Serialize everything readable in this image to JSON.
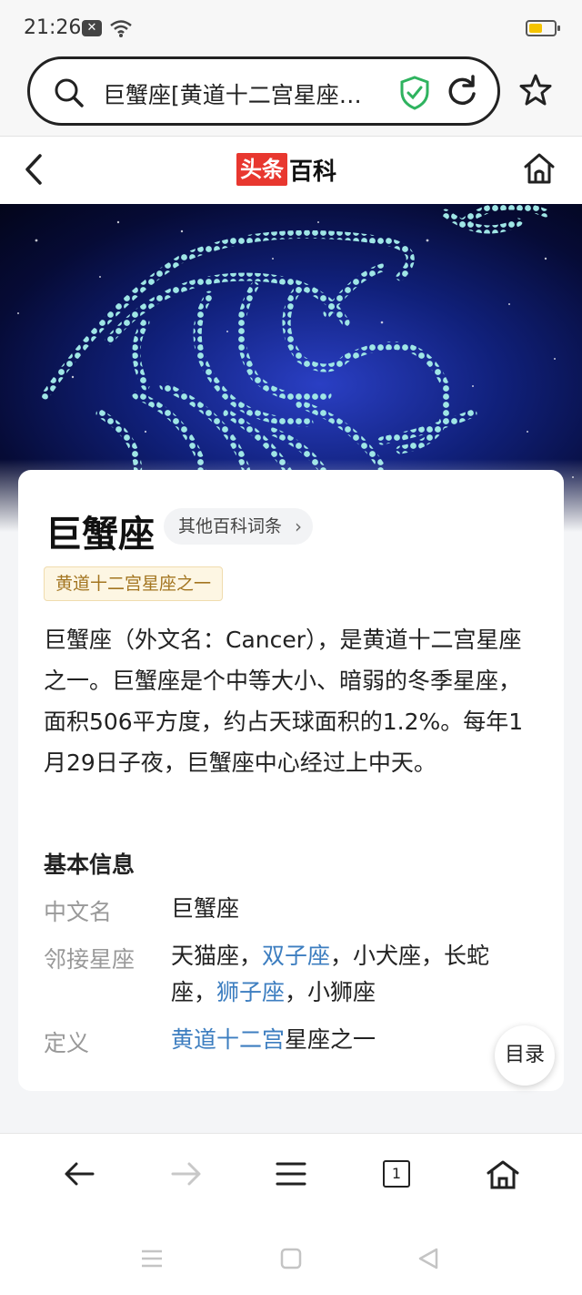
{
  "status": {
    "time": "21:26",
    "notification_icon": "close-box-icon",
    "wifi_icon": "wifi-icon",
    "battery_color": "#f5c400"
  },
  "address_bar": {
    "text": "巨蟹座[黄道十二宫星座之一]",
    "security_color": "#2fb35f"
  },
  "header": {
    "logo_part1": "头条",
    "logo_part2": "百科",
    "logo_color": "#e8372f"
  },
  "article": {
    "title": "巨蟹座",
    "other_entries_label": "其他百科词条",
    "tag": "黄道十二宫星座之一",
    "summary": "巨蟹座（外文名：Cancer），是黄道十二宫星座之一。巨蟹座是个中等大小、暗弱的冬季星座，面积506平方度，约占天球面积的1.2%。每年1月29日子夜，巨蟹座中心经过上中天。",
    "basic_info_title": "基本信息",
    "info": {
      "chinese_name_label": "中文名",
      "chinese_name_value": "巨蟹座",
      "adjacent_label": "邻接星座",
      "adjacent_parts": [
        "天猫座，",
        "双子座",
        "，小犬座，长蛇座，",
        "狮子座",
        "，小狮座"
      ],
      "definition_label": "定义",
      "definition_link": "黄道十二宫",
      "definition_rest": "星座之一"
    },
    "link_color": "#3d7ec0"
  },
  "toc_label": "目录",
  "bottom_nav": {
    "tab_count": "1"
  }
}
